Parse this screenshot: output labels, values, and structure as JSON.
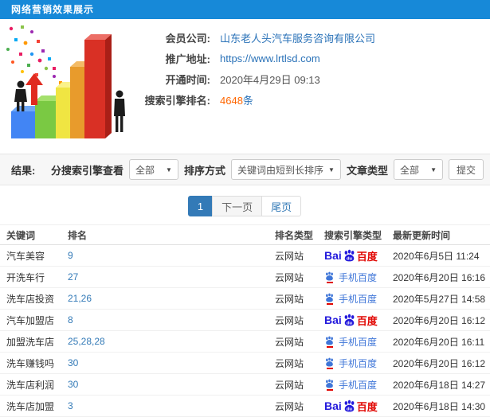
{
  "header": {
    "title": "网络营销效果展示"
  },
  "info": {
    "company_label": "会员公司:",
    "company": "山东老人头汽车服务咨询有限公司",
    "url_label": "推广地址:",
    "url": "https://www.lrtlsd.com",
    "open_label": "开通时间:",
    "open_time": "2020年4月29日 09:13",
    "rank_label": "搜索引擎排名:",
    "rank_count": "4648",
    "rank_unit": "条"
  },
  "filters": {
    "section_label": "结果:",
    "engine_label": "分搜索引擎查看",
    "engine_value": "全部",
    "sort_label": "排序方式",
    "sort_value": "关键词由短到长排序",
    "article_label": "文章类型",
    "article_value": "全部",
    "submit": "提交"
  },
  "pagination": {
    "current": "1",
    "next": "下一页",
    "last": "尾页"
  },
  "table": {
    "columns": [
      "关键词",
      "排名",
      "排名类型",
      "搜索引擎类型",
      "最新更新时间"
    ],
    "rows": [
      {
        "keyword": "汽车美容",
        "rank": "9",
        "rank_type": "云网站",
        "engine": "baidu-pc",
        "time": "2020年6月5日 11:24"
      },
      {
        "keyword": "开洗车行",
        "rank": "27",
        "rank_type": "云网站",
        "engine": "baidu-mobile",
        "time": "2020年6月20日 16:16"
      },
      {
        "keyword": "洗车店投资",
        "rank": "21,26",
        "rank_type": "云网站",
        "engine": "baidu-mobile",
        "time": "2020年5月27日 14:58"
      },
      {
        "keyword": "汽车加盟店",
        "rank": "8",
        "rank_type": "云网站",
        "engine": "baidu-pc",
        "time": "2020年6月20日 16:12"
      },
      {
        "keyword": "加盟洗车店",
        "rank": "25,28,28",
        "rank_type": "云网站",
        "engine": "baidu-mobile",
        "time": "2020年6月20日 16:11"
      },
      {
        "keyword": "洗车赚钱吗",
        "rank": "30",
        "rank_type": "云网站",
        "engine": "baidu-mobile",
        "time": "2020年6月20日 16:12"
      },
      {
        "keyword": "洗车店利润",
        "rank": "30",
        "rank_type": "云网站",
        "engine": "baidu-mobile",
        "time": "2020年6月18日 14:27"
      },
      {
        "keyword": "洗车店加盟",
        "rank": "3",
        "rank_type": "云网站",
        "engine": "baidu-pc",
        "time": "2020年6月18日 14:30"
      }
    ]
  },
  "engines": {
    "baidu_pc": {
      "bai": "Bai",
      "du": "du",
      "cn": "百度"
    },
    "baidu_mobile": {
      "label": "手机百度"
    }
  },
  "colors": {
    "header_bg": "#1789d8",
    "link_blue": "#2a72b8",
    "accent_orange": "#ff6600",
    "pagination_active": "#337ab7",
    "baidu_blue": "#2319dc",
    "baidu_red": "#e10602",
    "mobile_blue": "#3f76d8"
  }
}
